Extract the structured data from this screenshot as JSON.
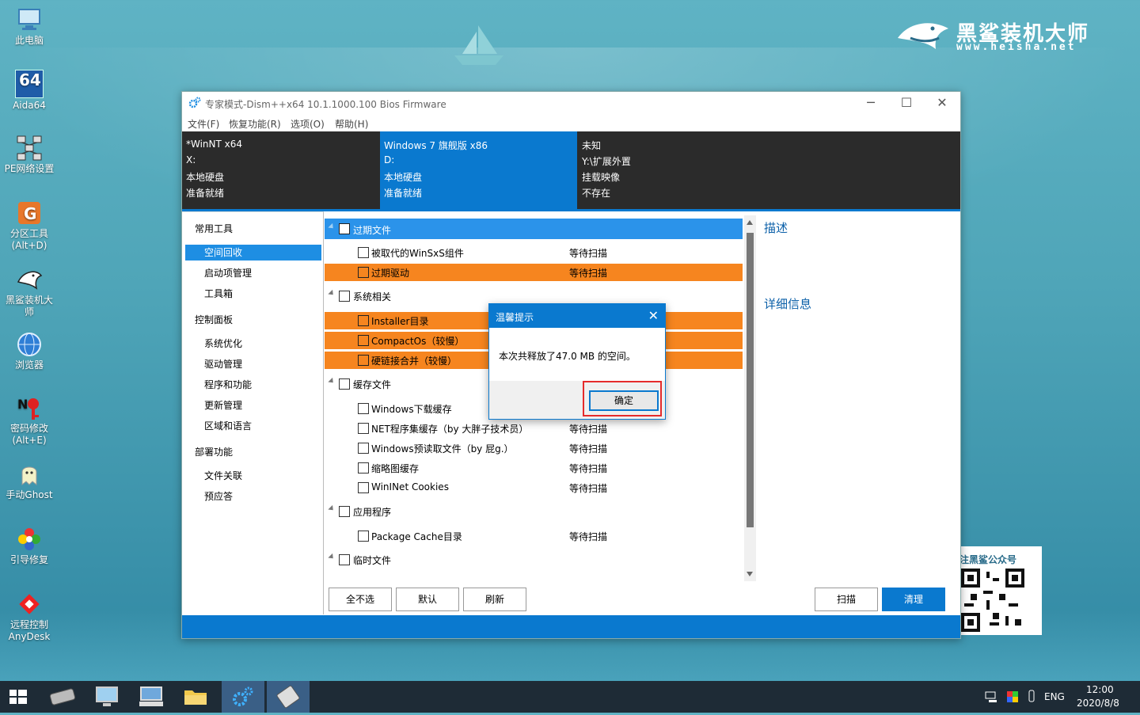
{
  "desktop": {
    "icons": [
      {
        "label": "此电脑",
        "label2": ""
      },
      {
        "label": "Aida64",
        "label2": "",
        "badge": "64"
      },
      {
        "label": "PE网络设置",
        "label2": ""
      },
      {
        "label": "分区工具",
        "label2": "(Alt+D)"
      },
      {
        "label": "黑鲨装机大",
        "label2": "师"
      },
      {
        "label": "浏览器",
        "label2": ""
      },
      {
        "label": "密码修改",
        "label2": "(Alt+E)"
      },
      {
        "label": "手动Ghost",
        "label2": ""
      },
      {
        "label": "引导修复",
        "label2": ""
      },
      {
        "label": "远程控制",
        "label2": "AnyDesk"
      }
    ],
    "brand": {
      "name": "黑鲨装机大师",
      "url": "www.heisha.net"
    },
    "qr_caption": "注黑鲨公众号"
  },
  "window": {
    "title": "专家模式-Dism++x64 10.1.1000.100 Bios Firmware",
    "controls": {
      "minimize": "─",
      "maximize": "☐",
      "close": "✕"
    },
    "menu": [
      "文件(F)",
      "恢复功能(R)",
      "选项(O)",
      "帮助(H)"
    ],
    "systems": [
      {
        "name": "*WinNT x64",
        "drive": "X:",
        "type": "本地硬盘",
        "state": "准备就绪"
      },
      {
        "name": "Windows 7 旗舰版 x86",
        "drive": "D:",
        "type": "本地硬盘",
        "state": "准备就绪"
      },
      {
        "name": "未知",
        "drive": "Y:\\扩展外置",
        "type": "挂载映像",
        "state": "不存在"
      }
    ],
    "nav": {
      "groups": [
        {
          "title": "常用工具",
          "items": [
            "空间回收",
            "启动项管理",
            "工具箱"
          ]
        },
        {
          "title": "控制面板",
          "items": [
            "系统优化",
            "驱动管理",
            "程序和功能",
            "更新管理",
            "区域和语言"
          ]
        },
        {
          "title": "部署功能",
          "items": [
            "文件关联",
            "预应答"
          ]
        }
      ],
      "selected": "空间回收"
    },
    "list": [
      {
        "kind": "group",
        "label": "过期文件",
        "status": "",
        "style": "selected"
      },
      {
        "kind": "item",
        "label": "被取代的WinSxS组件",
        "status": "等待扫描",
        "style": ""
      },
      {
        "kind": "item",
        "label": "过期驱动",
        "status": "等待扫描",
        "style": "orange"
      },
      {
        "kind": "group",
        "label": "系统相关",
        "status": "",
        "style": ""
      },
      {
        "kind": "item",
        "label": "Installer目录",
        "status": "",
        "style": "orange"
      },
      {
        "kind": "item",
        "label": "CompactOs（较慢）",
        "status": "",
        "style": "orange"
      },
      {
        "kind": "item",
        "label": "硬链接合并（较慢）",
        "status": "",
        "style": "orange"
      },
      {
        "kind": "group",
        "label": "缓存文件",
        "status": "",
        "style": ""
      },
      {
        "kind": "item",
        "label": "Windows下载缓存",
        "status": "",
        "style": ""
      },
      {
        "kind": "item",
        "label": "NET程序集缓存（by 大胖子技术员）",
        "status": "等待扫描",
        "style": ""
      },
      {
        "kind": "item",
        "label": "Windows预读取文件（by 屁g.）",
        "status": "等待扫描",
        "style": ""
      },
      {
        "kind": "item",
        "label": "缩略图缓存",
        "status": "等待扫描",
        "style": ""
      },
      {
        "kind": "item",
        "label": "WinINet Cookies",
        "status": "等待扫描",
        "style": ""
      },
      {
        "kind": "group",
        "label": "应用程序",
        "status": "",
        "style": ""
      },
      {
        "kind": "item",
        "label": "Package Cache目录",
        "status": "等待扫描",
        "style": ""
      },
      {
        "kind": "group",
        "label": "临时文件",
        "status": "",
        "style": ""
      }
    ],
    "description": {
      "title": "描述",
      "details_title": "详细信息"
    },
    "buttons": {
      "select_none": "全不选",
      "default": "默认",
      "refresh": "刷新",
      "scan": "扫描",
      "clean": "清理"
    }
  },
  "dialog": {
    "title": "温馨提示",
    "close": "✕",
    "message": "本次共释放了47.0 MB 的空间。",
    "ok": "确定"
  },
  "taskbar": {
    "lang": "ENG",
    "time": "12:00",
    "date": "2020/8/8"
  },
  "colors": {
    "accent": "#0a79cf",
    "highlight": "#f6851f",
    "selected_row": "#2b93ea",
    "info_bg": "#2b2b2b",
    "taskbar": "#1e2b36"
  }
}
